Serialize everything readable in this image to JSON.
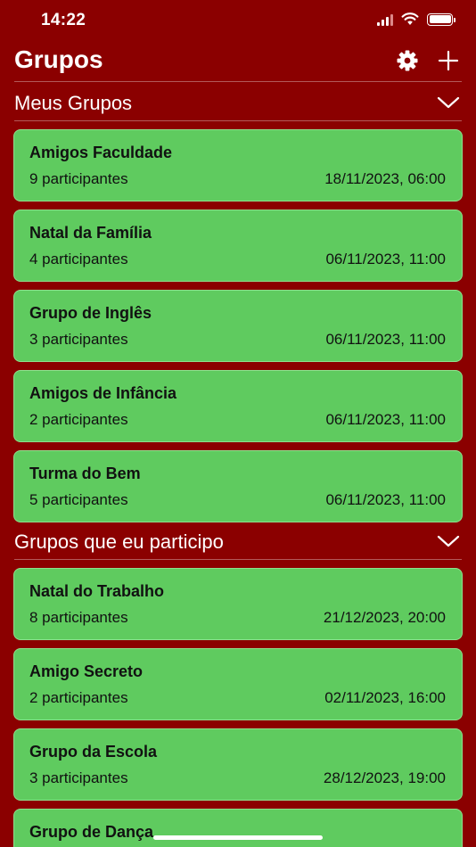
{
  "status": {
    "time": "14:22"
  },
  "header": {
    "title": "Grupos"
  },
  "sections": [
    {
      "title": "Meus Grupos",
      "groups": [
        {
          "name": "Amigos Faculdade",
          "participants": "9 participantes",
          "date": "18/11/2023, 06:00"
        },
        {
          "name": "Natal da Família",
          "participants": "4 participantes",
          "date": "06/11/2023, 11:00"
        },
        {
          "name": "Grupo de Inglês",
          "participants": "3 participantes",
          "date": "06/11/2023, 11:00"
        },
        {
          "name": "Amigos de Infância",
          "participants": "2 participantes",
          "date": "06/11/2023, 11:00"
        },
        {
          "name": "Turma do Bem",
          "participants": "5 participantes",
          "date": "06/11/2023, 11:00"
        }
      ]
    },
    {
      "title": "Grupos que eu participo",
      "groups": [
        {
          "name": "Natal do Trabalho",
          "participants": "8 participantes",
          "date": "21/12/2023, 20:00"
        },
        {
          "name": "Amigo Secreto",
          "participants": "2 participantes",
          "date": "02/11/2023, 16:00"
        },
        {
          "name": "Grupo da Escola",
          "participants": "3 participantes",
          "date": "28/12/2023, 19:00"
        },
        {
          "name": "Grupo de Dança",
          "participants": "",
          "date": ""
        }
      ]
    }
  ],
  "colors": {
    "background": "#8b0000",
    "card": "#5fcb5f",
    "card_border": "#8ee08e",
    "text_dark": "#111111"
  },
  "icons": [
    "signal-icon",
    "wifi-icon",
    "battery-icon",
    "gear-icon",
    "plus-icon",
    "chevron-down-icon"
  ]
}
